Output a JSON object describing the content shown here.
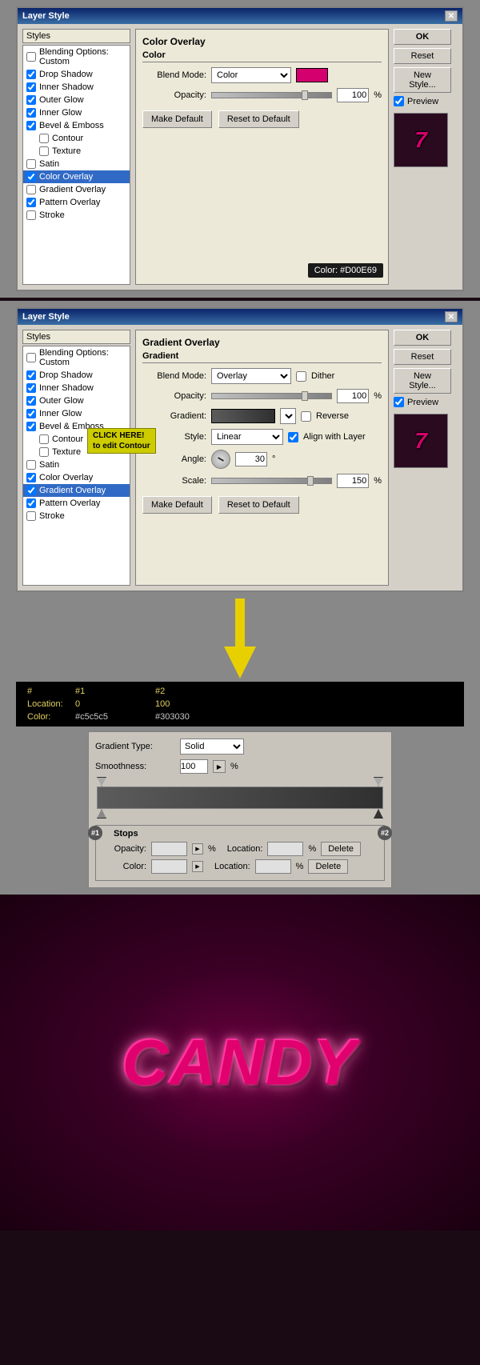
{
  "dialog1": {
    "title": "Layer Style",
    "styles_header": "Styles",
    "styles": [
      {
        "label": "Blending Options: Custom",
        "checked": false,
        "active": false
      },
      {
        "label": "Drop Shadow",
        "checked": true,
        "active": false
      },
      {
        "label": "Inner Shadow",
        "checked": true,
        "active": false
      },
      {
        "label": "Outer Glow",
        "checked": true,
        "active": false
      },
      {
        "label": "Inner Glow",
        "checked": true,
        "active": false
      },
      {
        "label": "Bevel & Emboss",
        "checked": true,
        "active": false
      },
      {
        "label": "Contour",
        "checked": false,
        "active": false,
        "sub": true
      },
      {
        "label": "Texture",
        "checked": false,
        "active": false,
        "sub": true
      },
      {
        "label": "Satin",
        "checked": false,
        "active": false
      },
      {
        "label": "Color Overlay",
        "checked": true,
        "active": true
      },
      {
        "label": "Gradient Overlay",
        "checked": false,
        "active": false
      },
      {
        "label": "Pattern Overlay",
        "checked": true,
        "active": false
      },
      {
        "label": "Stroke",
        "checked": false,
        "active": false
      }
    ],
    "panel_title": "Color Overlay",
    "section_title": "Color",
    "blend_mode_label": "Blend Mode:",
    "blend_mode_value": "Color",
    "opacity_label": "Opacity:",
    "opacity_value": "100",
    "opacity_unit": "%",
    "make_default": "Make Default",
    "reset_to_default": "Reset to Default",
    "color_tooltip": "Color: #D00E69",
    "buttons": {
      "ok": "OK",
      "reset": "Reset",
      "new_style": "New Style...",
      "preview_label": "Preview"
    }
  },
  "dialog2": {
    "title": "Layer Style",
    "styles_header": "Styles",
    "styles": [
      {
        "label": "Blending Options: Custom",
        "checked": false,
        "active": false
      },
      {
        "label": "Drop Shadow",
        "checked": true,
        "active": false
      },
      {
        "label": "Inner Shadow",
        "checked": true,
        "active": false
      },
      {
        "label": "Outer Glow",
        "checked": true,
        "active": false
      },
      {
        "label": "Inner Glow",
        "checked": true,
        "active": false
      },
      {
        "label": "Bevel & Emboss",
        "checked": true,
        "active": false
      },
      {
        "label": "Contour",
        "checked": false,
        "active": false,
        "sub": true
      },
      {
        "label": "Texture",
        "checked": false,
        "active": false,
        "sub": true
      },
      {
        "label": "Satin",
        "checked": false,
        "active": false
      },
      {
        "label": "Color Overlay",
        "checked": true,
        "active": false
      },
      {
        "label": "Gradient Overlay",
        "checked": true,
        "active": true
      },
      {
        "label": "Pattern Overlay",
        "checked": true,
        "active": false
      },
      {
        "label": "Stroke",
        "checked": false,
        "active": false
      }
    ],
    "panel_title": "Gradient Overlay",
    "section_title": "Gradient",
    "blend_mode_label": "Blend Mode:",
    "blend_mode_value": "Overlay",
    "dither_label": "Dither",
    "opacity_label": "Opacity:",
    "opacity_value": "100",
    "opacity_unit": "%",
    "gradient_label": "Gradient:",
    "reverse_label": "Reverse",
    "style_label": "Style:",
    "style_value": "Linear",
    "align_label": "Align with Layer",
    "angle_label": "Angle:",
    "angle_value": "30",
    "angle_unit": "°",
    "scale_label": "Scale:",
    "scale_value": "150",
    "scale_unit": "%",
    "make_default": "Make Default",
    "reset_to_default": "Reset to Default",
    "click_tooltip_line1": "CLICK HERE!",
    "click_tooltip_line2": "to edit Contour",
    "buttons": {
      "ok": "OK",
      "reset": "Reset",
      "new_style": "New Style...",
      "preview_label": "Preview"
    }
  },
  "gradient_table": {
    "col_hash": "#",
    "col1": "#1",
    "col2": "#2",
    "location_label": "Location:",
    "loc1": "0",
    "loc2": "100",
    "color_label": "Color:",
    "color1": "#c5c5c5",
    "color2": "#303030"
  },
  "gradient_editor": {
    "gradient_type_label": "Gradient Type:",
    "gradient_type_value": "Solid",
    "smoothness_label": "Smoothness:",
    "smoothness_value": "100",
    "smoothness_unit": "%",
    "stops_label": "Stops",
    "stop1_label": "#1",
    "stop2_label": "#2",
    "opacity_label": "Opacity:",
    "opacity_unit": "%",
    "location_label": "Location:",
    "location_unit": "%",
    "delete_label": "Delete",
    "color_label": "Color:",
    "color_location_label": "Location:",
    "color_location_unit": "%",
    "color_delete_label": "Delete"
  },
  "canvas": {
    "text": "CANDY"
  },
  "arrow": {
    "label": "↓"
  }
}
